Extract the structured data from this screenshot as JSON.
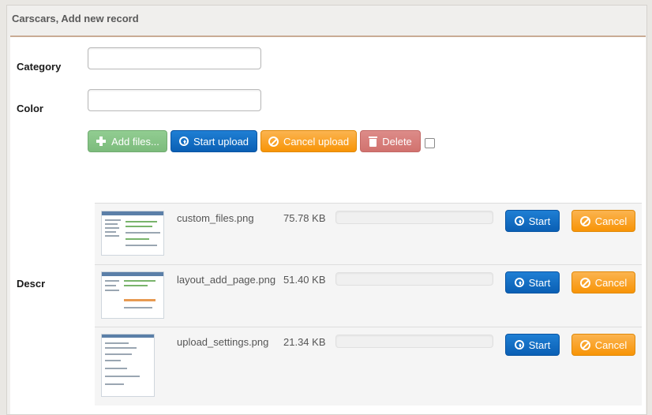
{
  "header": {
    "title": "Carscars, Add new record"
  },
  "form": {
    "category_label": "Category",
    "category_value": "",
    "color_label": "Color",
    "color_value": "",
    "descr_label": "Descr"
  },
  "toolbar": {
    "add_files": "Add files...",
    "start_upload": "Start upload",
    "cancel_upload": "Cancel upload",
    "delete": "Delete"
  },
  "files": [
    {
      "name": "custom_files.png",
      "size": "75.78 KB",
      "start": "Start",
      "cancel": "Cancel"
    },
    {
      "name": "layout_add_page.png",
      "size": "51.40 KB",
      "start": "Start",
      "cancel": "Cancel"
    },
    {
      "name": "upload_settings.png",
      "size": "21.34 KB",
      "start": "Start",
      "cancel": "Cancel"
    }
  ],
  "colors": {
    "add": "#7fc17f",
    "start": "#0e66c2",
    "cancel": "#f89406",
    "delete": "#d47a76",
    "header_border": "#c9ab95"
  },
  "icons": {
    "add": "plus-icon",
    "start": "circle-arrow-up-icon",
    "cancel": "ban-icon",
    "delete": "trash-icon"
  }
}
